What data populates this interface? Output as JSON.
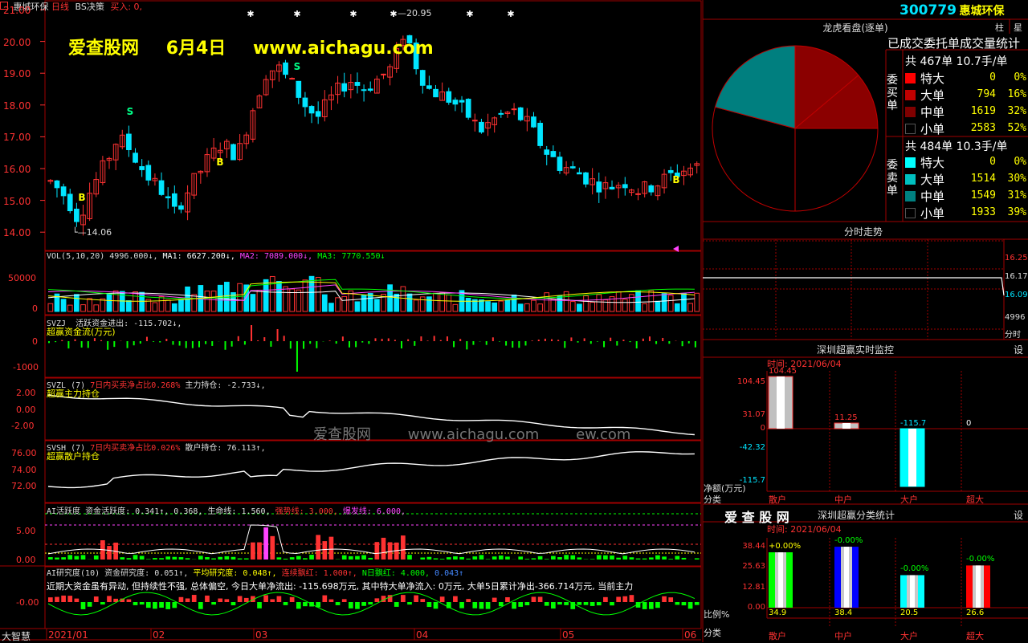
{
  "header": {
    "stock_name": "惠城环保",
    "period": "日线",
    "strategy": "BS决策",
    "buy_signal": "买入: 0,"
  },
  "watermark": {
    "site": "爱查股网",
    "date": "6月4日",
    "url": "www.aichagu.com",
    "faint_site": "爱查股网",
    "faint_url": "www.aichagu.com",
    "faint_tail": "ew.com"
  },
  "price_axis": [
    "21.00",
    "20.00",
    "19.00",
    "18.00",
    "17.00",
    "16.00",
    "15.00",
    "14.00"
  ],
  "price_annotations": {
    "high": "20.95",
    "low": "14.06"
  },
  "signals": {
    "buy": "B",
    "sell": "S"
  },
  "vol_panel": {
    "label": "VOL(5,10,20)",
    "value": "4996.000↓,",
    "ma1": "MA1: 6627.200↓,",
    "ma2": "MA2: 7089.000↓,",
    "ma3": "MA3: 7770.550↓",
    "axis": [
      "50000",
      "0"
    ]
  },
  "svzj_panel": {
    "label": "SVZJ",
    "desc": "活跃资金进出: -115.702↓,",
    "sub": "超赢资金流(万元)",
    "axis": [
      "0",
      "-1000"
    ]
  },
  "svzl_panel": {
    "label": "SVZL (7)",
    "desc": "7日内买卖净占比0.268%",
    "desc2": "主力持仓: -2.733↓,",
    "sub": "超赢主力持仓",
    "axis": [
      "2.00",
      "0.00",
      "-2.00"
    ]
  },
  "svsh_panel": {
    "label": "SVSH (7)",
    "desc": "7日内买卖净占比0.026%",
    "desc2": "散户持仓: 76.113↑,",
    "sub": "超赢散户持仓",
    "axis": [
      "76.00",
      "74.00",
      "72.00"
    ]
  },
  "ai_panel": {
    "label": "AI活跃度",
    "desc": "资金活跃度: 0.341↑, 0.368,",
    "life": "生命线: 1.560,",
    "strong": "强势线: 3.000,",
    "burst": "爆发线: 6.000,",
    "axis": [
      "5.00",
      "0.00"
    ]
  },
  "research_panel": {
    "label": "AI研究度(10)",
    "desc": "资金研究度: 0.051↑,",
    "avg": "平均研究度: 0.048↑,",
    "cont": "连续飘红: 1.000↑,",
    "nday": "N日飘红: 4.000,",
    "val": "0.043↑",
    "commentary": "近期大资金虽有异动, 但持续性不强, 总体偏空, 今日大单净流出: -115.698万元, 其中特大单净流入: 0万元, 大单5日累计净出-366.714万元, 当前主力",
    "axis": [
      "-0.00"
    ]
  },
  "x_axis": {
    "brand": "大智慧",
    "labels": [
      "2021/01",
      "02",
      "03",
      "04",
      "05",
      "06"
    ]
  },
  "right": {
    "code": "300779",
    "name": "惠城环保",
    "btn": "柱",
    "btn2": "星",
    "lhb_title": "龙虎看盘(逐单)",
    "lhb_subtitle": "已成交委托单成交量统计",
    "buy_label": "委买单",
    "buy_summary": "共 467单 10.7手/单",
    "buy_rows": [
      {
        "name": "特大",
        "count": "0",
        "pct": "0%",
        "color": "#ff0000"
      },
      {
        "name": "大单",
        "count": "794",
        "pct": "16%",
        "color": "#c00000"
      },
      {
        "name": "中单",
        "count": "1619",
        "pct": "32%",
        "color": "#800000"
      },
      {
        "name": "小单",
        "count": "2583",
        "pct": "52%",
        "color": "#000000"
      }
    ],
    "sell_label": "委卖单",
    "sell_summary": "共 484单 10.3手/单",
    "sell_rows": [
      {
        "name": "特大",
        "count": "0",
        "pct": "0%",
        "color": "#00ffff"
      },
      {
        "name": "大单",
        "count": "1514",
        "pct": "30%",
        "color": "#00c0c0"
      },
      {
        "name": "中单",
        "count": "1549",
        "pct": "31%",
        "color": "#008080"
      },
      {
        "name": "小单",
        "count": "1933",
        "pct": "39%",
        "color": "#000000"
      }
    ],
    "intraday_title": "分时走势",
    "intraday_axis": [
      "16.25",
      "16.17",
      "16.09",
      "4996",
      "分时"
    ],
    "monitor_title": "深圳超赢实时监控",
    "monitor_btn": "设",
    "monitor_time": "时间: 2021/06/04",
    "monitor_axis": [
      "104.45",
      "31.07",
      "0",
      "-42.32",
      "-115.7"
    ],
    "monitor_unit": "净额(万元)",
    "monitor_cat_label": "分类",
    "monitor_bars": [
      {
        "cat": "散户",
        "value": 104.45,
        "label": "104.45"
      },
      {
        "cat": "中户",
        "value": 11.25,
        "label": "11.25"
      },
      {
        "cat": "大户",
        "value": -115.7,
        "label": "-115.7"
      },
      {
        "cat": "超大",
        "value": 0,
        "label": "0"
      }
    ],
    "class_logo": "爱 查 股 网",
    "class_title": "深圳超赢分类统计",
    "class_btn": "设",
    "class_time": "时间: 2021/06/04",
    "class_axis": [
      "38.44",
      "25.63",
      "12.81",
      "0.00"
    ],
    "class_ratio_label": "比例%",
    "class_cat_label": "分类",
    "class_bars": [
      {
        "cat": "散户",
        "ratio": 34.9,
        "ratio_label": "34.9",
        "chg": "+0.00%",
        "color": "#00ff00"
      },
      {
        "cat": "中户",
        "ratio": 38.4,
        "ratio_label": "38.4",
        "chg": "-0.00%",
        "color": "#0000ff"
      },
      {
        "cat": "大户",
        "ratio": 20.5,
        "ratio_label": "20.5",
        "chg": "-0.00%",
        "color": "#00ffff"
      },
      {
        "cat": "超大",
        "ratio": 26.6,
        "ratio_label": "26.6",
        "chg": "-0.00%",
        "color": "#ff0000"
      }
    ]
  },
  "colors": {
    "up": "#ff3232",
    "down": "#00e5ff",
    "grid": "#a00000",
    "yellow": "#ffff00",
    "white": "#ffffff"
  }
}
